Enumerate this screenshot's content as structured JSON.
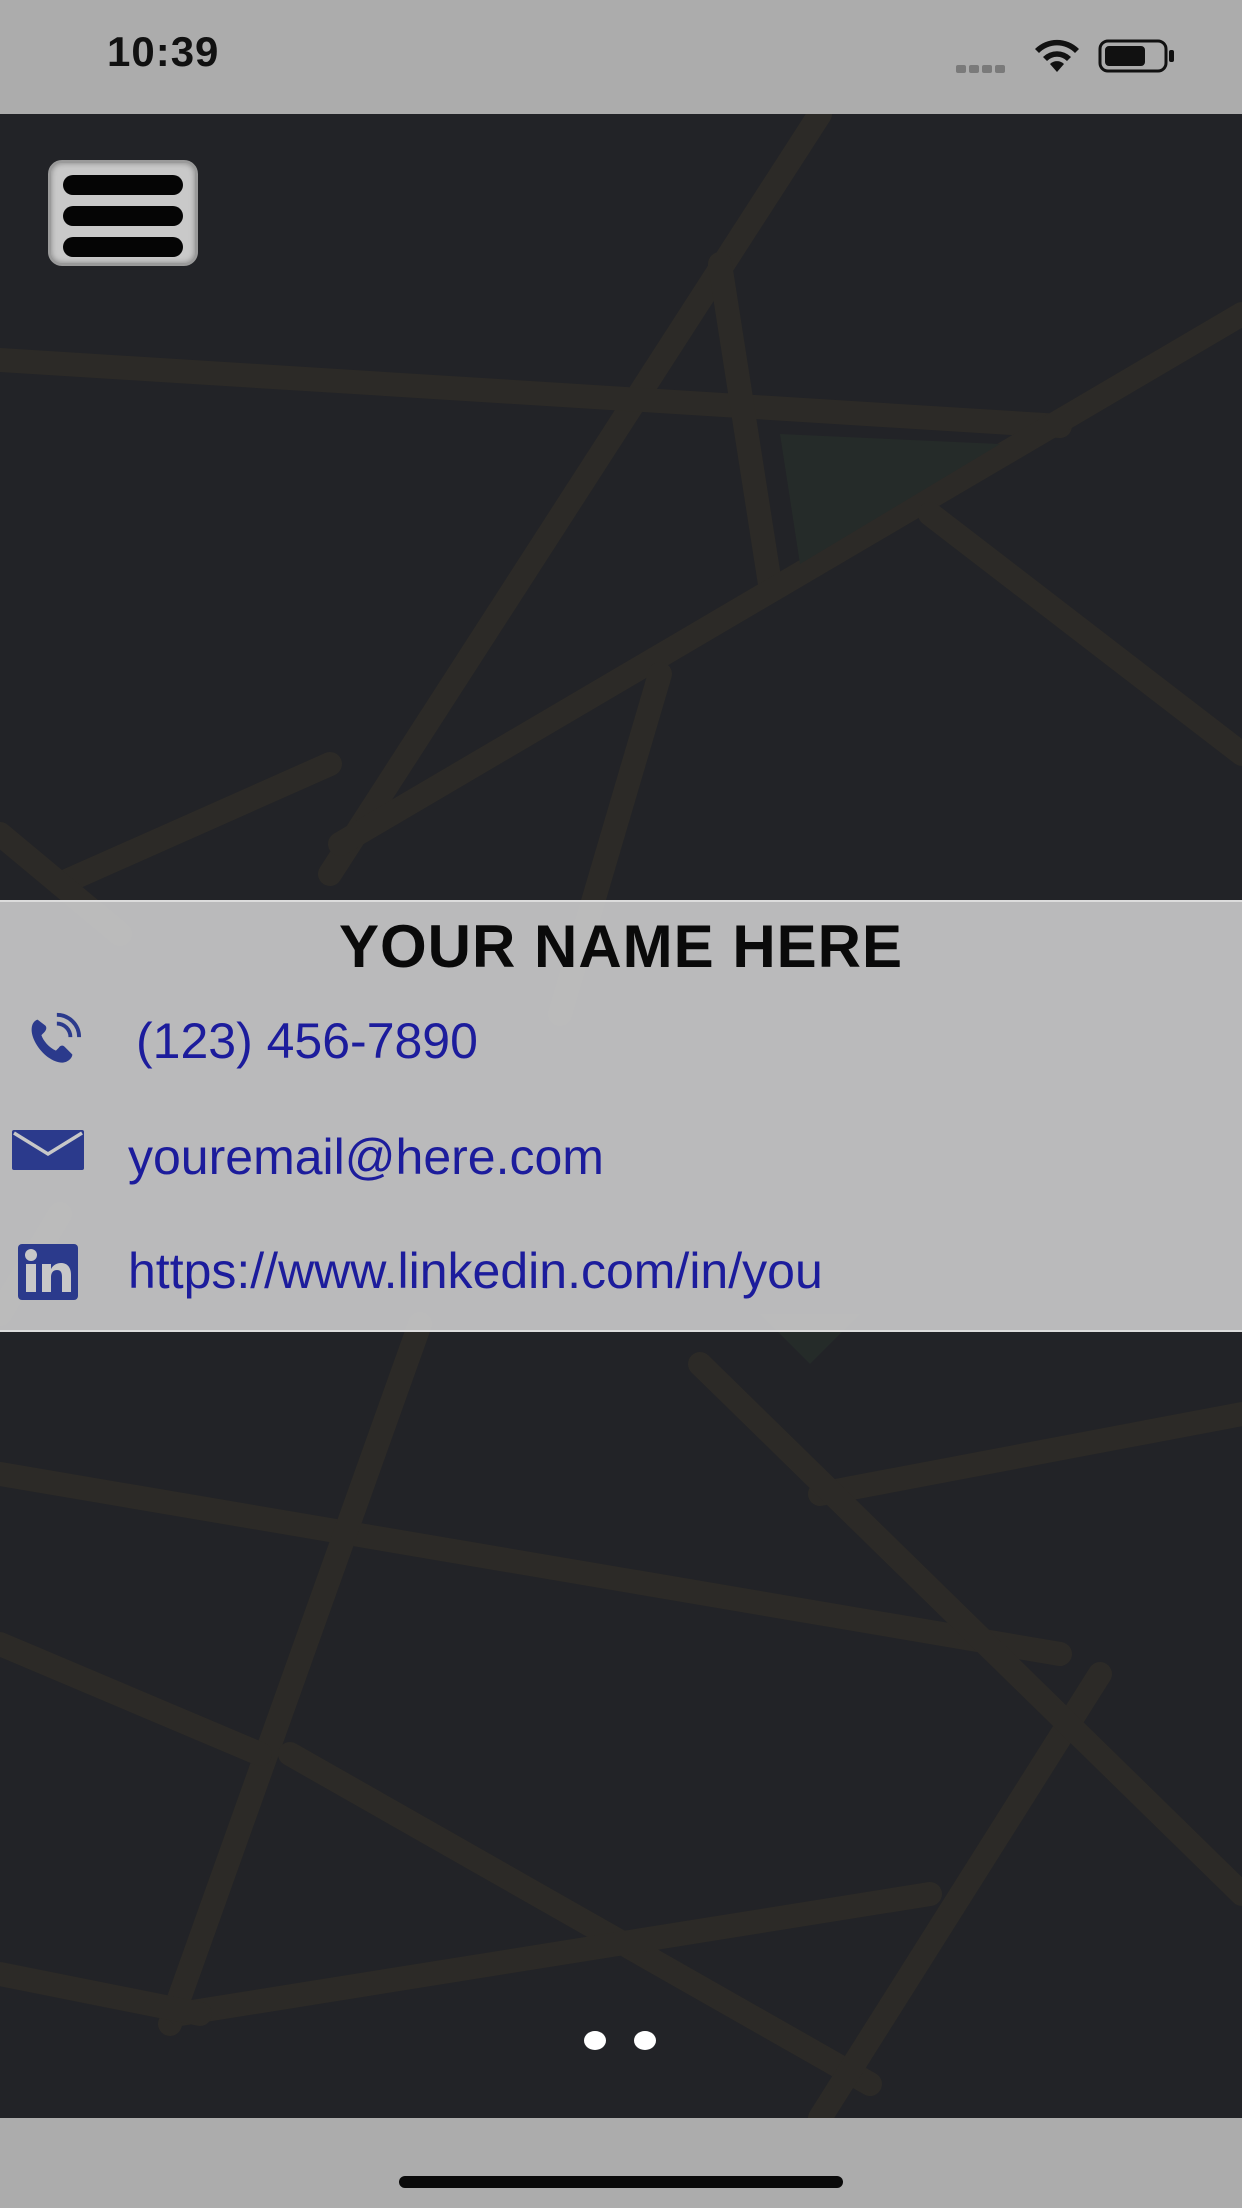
{
  "status_bar": {
    "time": "10:39"
  },
  "menu": {
    "icon": "hamburger-menu-icon"
  },
  "contact_card": {
    "name": "YOUR NAME HERE",
    "phone": "(123) 456-7890",
    "email": "youremail@here.com",
    "linkedin": "https://www.linkedin.com/in/you",
    "icons": {
      "phone": "phone-icon",
      "email": "envelope-icon",
      "linkedin": "linkedin-icon"
    }
  },
  "page_indicator": {
    "page_count": 2
  },
  "colors": {
    "status_bar_bg": "#acacac",
    "map_bg": "#222327",
    "road_color": "#2c2a27",
    "link_text": "#1c1c9c",
    "icon_blue": "#2b3a8c",
    "card_bg": "#c8c8c8"
  }
}
